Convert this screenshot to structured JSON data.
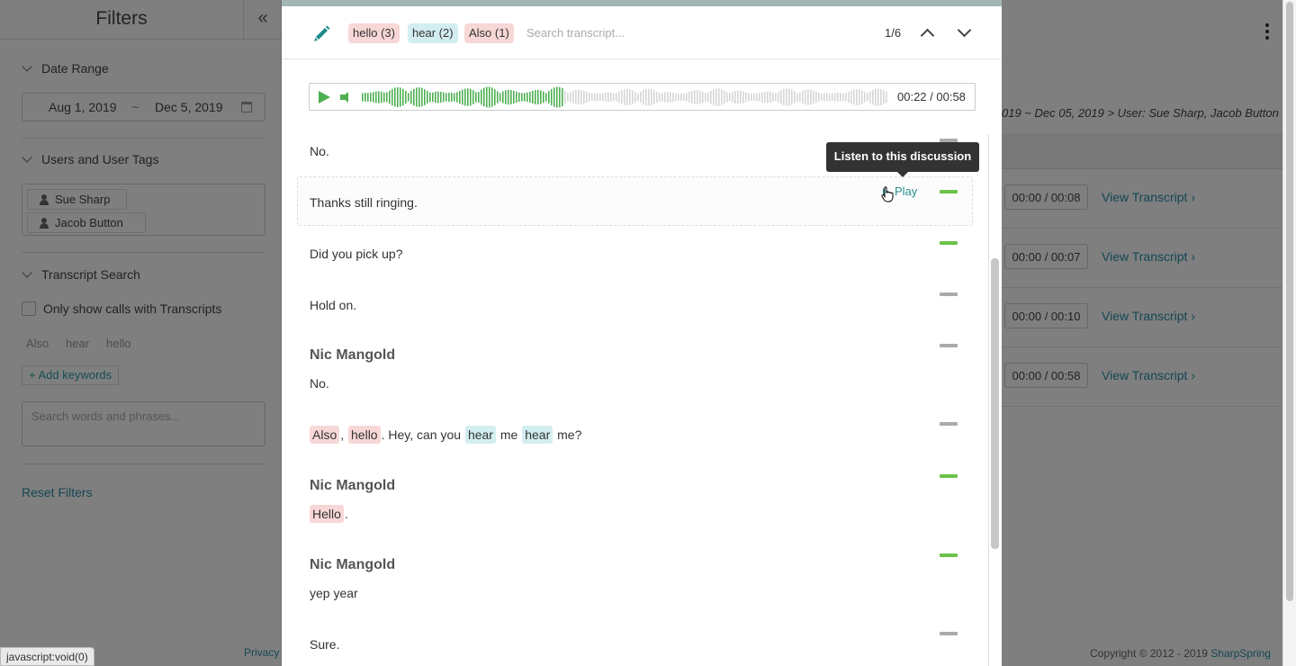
{
  "filters": {
    "title": "Filters",
    "collapse_icon": "«",
    "date_range": {
      "label": "Date Range",
      "start": "Aug 1, 2019",
      "separator": "~",
      "end": "Dec 5, 2019"
    },
    "users": {
      "label": "Users and User Tags",
      "tags": [
        "Sue Sharp",
        "Jacob Button"
      ]
    },
    "transcript_search": {
      "label": "Transcript Search",
      "checkbox_label": "Only show calls with Transcripts",
      "keywords": [
        "Also",
        "hear",
        "hello"
      ],
      "add_keywords": "+ Add keywords",
      "search_placeholder": "Search words and phrases..."
    },
    "reset": "Reset Filters",
    "privacy": "Privacy"
  },
  "page": {
    "breadcrumb": "019 ~ Dec 05, 2019 > User: Sue Sharp, Jacob Button",
    "rows": [
      {
        "duration": "00:00 / 00:08",
        "link": "View Transcript"
      },
      {
        "duration": "00:00 / 00:07",
        "link": "View Transcript"
      },
      {
        "duration": "00:00 / 00:10",
        "link": "View Transcript"
      },
      {
        "duration": "00:00 / 00:58",
        "link": "View Transcript"
      }
    ],
    "copyright": "Copyright © 2012 - 2019",
    "brand": "SharpSpring"
  },
  "status_bar": "javascript:void(0)",
  "modal": {
    "chips": [
      {
        "label": "hello (3)",
        "color": "pink"
      },
      {
        "label": "hear (2)",
        "color": "blue"
      },
      {
        "label": "Also (1)",
        "color": "pink"
      }
    ],
    "search_placeholder": "Search transcript...",
    "counter": "1/6",
    "player": {
      "time": "00:22 / 00:58",
      "progress": 0.38,
      "accent": "#4caf50"
    },
    "tooltip": "Listen to this discussion",
    "play_label": "Play",
    "transcript": {
      "l1": "No.",
      "l2": "Thanks still ringing.",
      "l3": "Did you pick up?",
      "l4": "Hold on.",
      "s1": "Nic Mangold",
      "l5": "No.",
      "l6": {
        "w1": "Also",
        "p1": ",",
        "w2": "hello",
        "p2": ". Hey, can you",
        "w3": "hear",
        "p3": "me",
        "w4": "hear",
        "p4": "me?"
      },
      "s2": "Nic Mangold",
      "l7": {
        "w1": "Hello",
        "p1": "."
      },
      "s3": "Nic Mangold",
      "l8": "yep year",
      "l9": "Sure."
    }
  }
}
